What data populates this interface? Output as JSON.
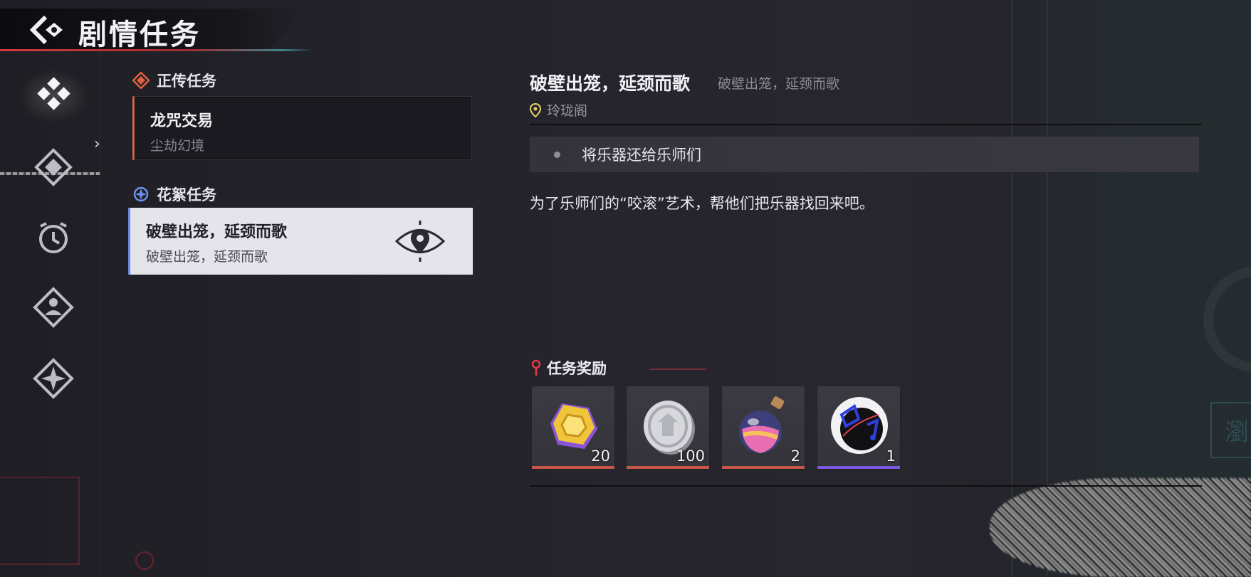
{
  "header": {
    "title": "剧情任务"
  },
  "nav": {
    "items": [
      {
        "icon": "main-quest-icon",
        "active": true
      },
      {
        "icon": "side-quest-icon",
        "active": false
      },
      {
        "icon": "timed-quest-icon",
        "active": false
      },
      {
        "icon": "character-quest-icon",
        "active": false
      },
      {
        "icon": "star-quest-icon",
        "active": false
      }
    ]
  },
  "quests": {
    "main_section": {
      "label": "正传任务",
      "color": "#e0603c"
    },
    "main_quest": {
      "title": "龙咒交易",
      "subtitle": "尘劫幻境"
    },
    "side_section": {
      "label": "花絮任务",
      "color": "#6f8ff0"
    },
    "side_quest": {
      "title": "破壁出笼，延颈而歌",
      "subtitle": "破壁出笼，延颈而歌",
      "selected": true
    }
  },
  "detail": {
    "title": "破壁出笼，延颈而歌",
    "subtitle": "破壁出笼，延颈而歌",
    "location": "玲珑阁",
    "objective": "将乐器还给乐师们",
    "description": "为了乐师们的“咬滚”艺术，帮他们把乐器找回来吧。"
  },
  "rewards": {
    "label": "任务奖励",
    "items": [
      {
        "icon": "gold-gem-icon",
        "count": "20",
        "bar_color": "#c4574a"
      },
      {
        "icon": "silver-coin-icon",
        "count": "100",
        "bar_color": "#c4574a"
      },
      {
        "icon": "potion-flask-icon",
        "count": "2",
        "bar_color": "#c4574a"
      },
      {
        "icon": "music-record-icon",
        "count": "1",
        "bar_color": "#7a5be0"
      }
    ]
  }
}
